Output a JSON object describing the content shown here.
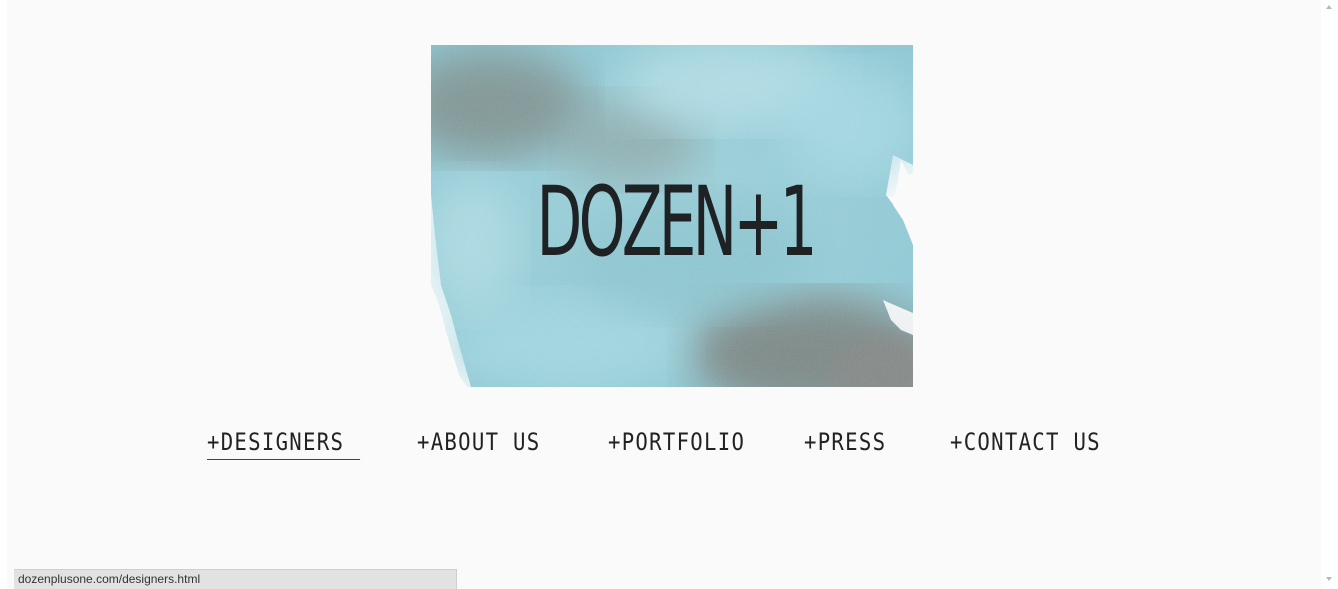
{
  "logo": {
    "text": "DOZEN+1",
    "colors": {
      "ink": "#1e2224",
      "watercolor_light": "#a9dce6",
      "watercolor_mid": "#7fc2cf",
      "watercolor_dark": "#7e8b88"
    }
  },
  "nav": {
    "items": [
      {
        "label": "+DESIGNERS",
        "active": true
      },
      {
        "label": "+ABOUT US",
        "active": false
      },
      {
        "label": "+PORTFOLIO",
        "active": false
      },
      {
        "label": "+PRESS",
        "active": false
      },
      {
        "label": "+CONTACT US",
        "active": false
      }
    ],
    "underline_color": "#1f4b7a"
  },
  "status_bar": {
    "url": "dozenplusone.com/designers.html"
  },
  "scrollbar": {
    "up_icon": "triangle-up",
    "down_icon": "triangle-down"
  }
}
